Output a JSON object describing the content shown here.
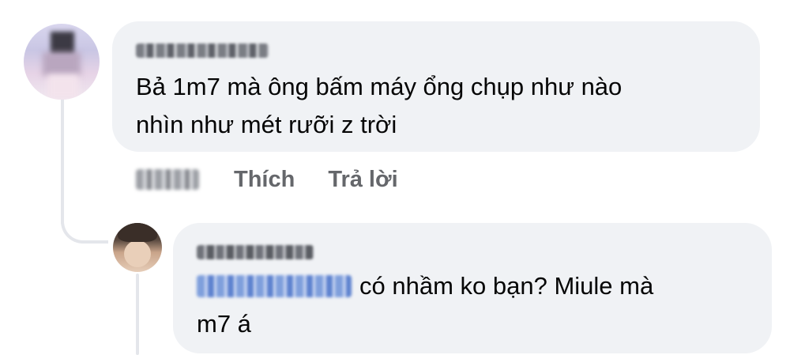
{
  "comment": {
    "author_name_blurred": true,
    "text": "Bả 1m7 mà ông bấm máy ổng chụp như nào nhìn như mét rưỡi z trời",
    "text_line1": "Bả 1m7 mà ông bấm máy ổng chụp như nào",
    "text_line2": "nhìn như mét rưỡi z trời",
    "timestamp_blurred": true,
    "actions": {
      "like": "Thích",
      "reply": "Trả lời"
    }
  },
  "reply": {
    "author_name_blurred": true,
    "mention_blurred": true,
    "text_line1": "có nhầm ko bạn? Miule mà",
    "text_line2": "m7 á"
  },
  "colors": {
    "bubble_bg": "#f0f2f5",
    "text": "#050505",
    "secondary_text": "#65676b",
    "thread_line": "#e4e6eb",
    "mention": "#385898"
  }
}
